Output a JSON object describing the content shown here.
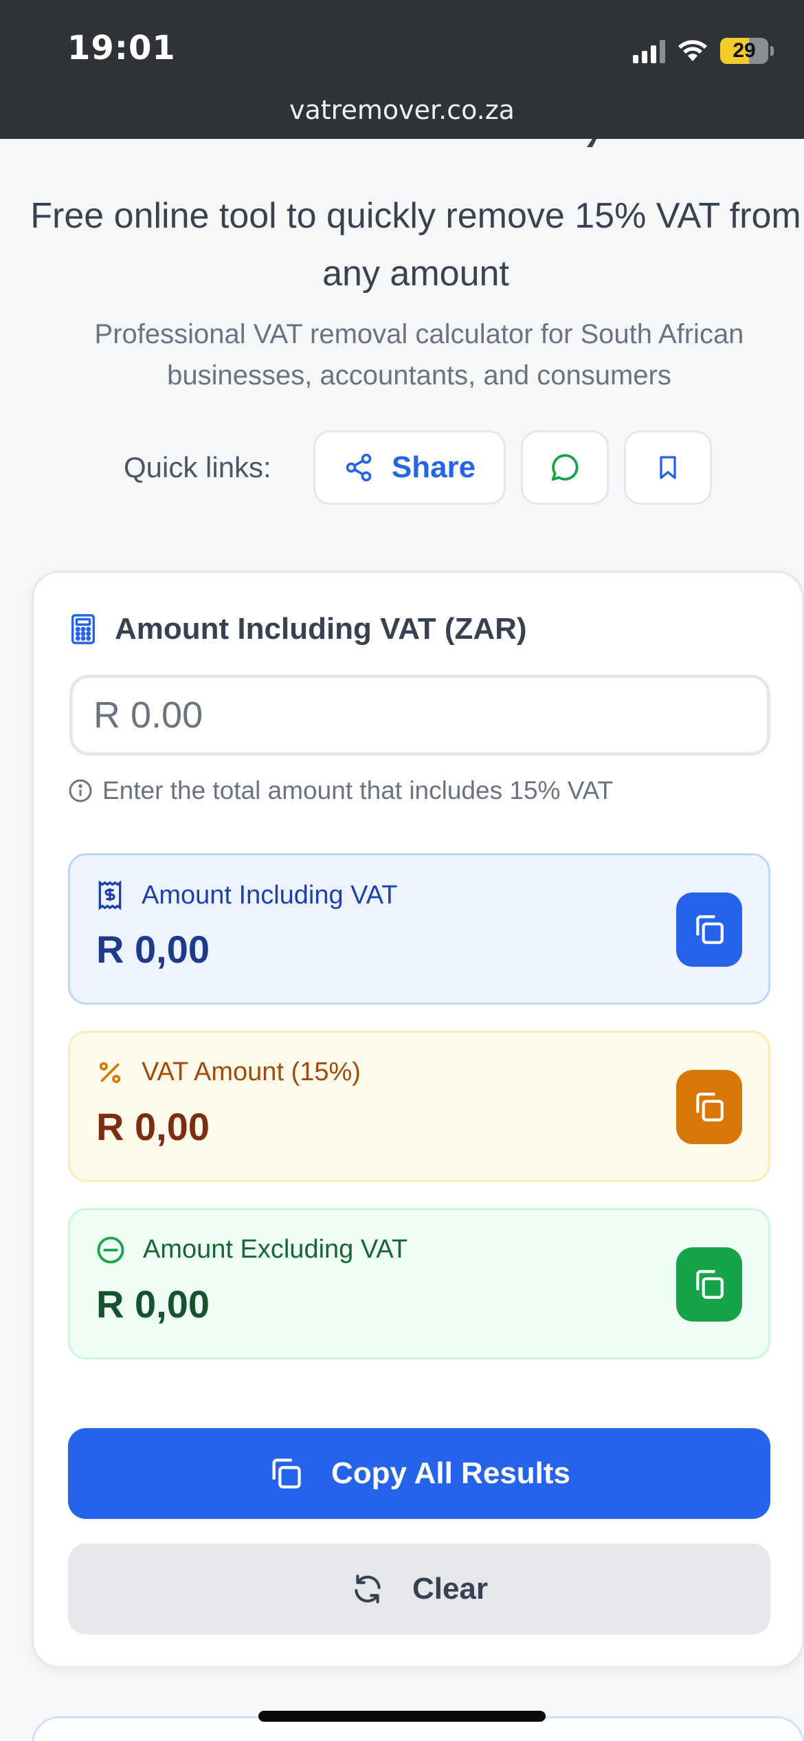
{
  "status_bar": {
    "time": "19:01",
    "battery": "29",
    "url": "vatremover.co.za"
  },
  "header": {
    "subtitle": "Free online tool to quickly remove 15% VAT from any amount",
    "description": "Professional VAT removal calculator for South African businesses, accountants, and consumers"
  },
  "quick_links": {
    "label": "Quick links:",
    "share_label": "Share"
  },
  "calculator": {
    "title": "Amount Including VAT (ZAR)",
    "input_placeholder": "R 0.00",
    "hint": "Enter the total amount that includes 15% VAT",
    "results": {
      "including": {
        "label": "Amount Including VAT",
        "value": "R 0,00"
      },
      "vat": {
        "label": "VAT Amount (15%)",
        "value": "R 0,00"
      },
      "excluding": {
        "label": "Amount Excluding VAT",
        "value": "R 0,00"
      }
    },
    "copy_all_label": "Copy All Results",
    "clear_label": "Clear"
  },
  "colors": {
    "primary": "#2563eb",
    "amber": "#d97706",
    "green": "#16a34a",
    "status_bar": "#2f3236"
  }
}
